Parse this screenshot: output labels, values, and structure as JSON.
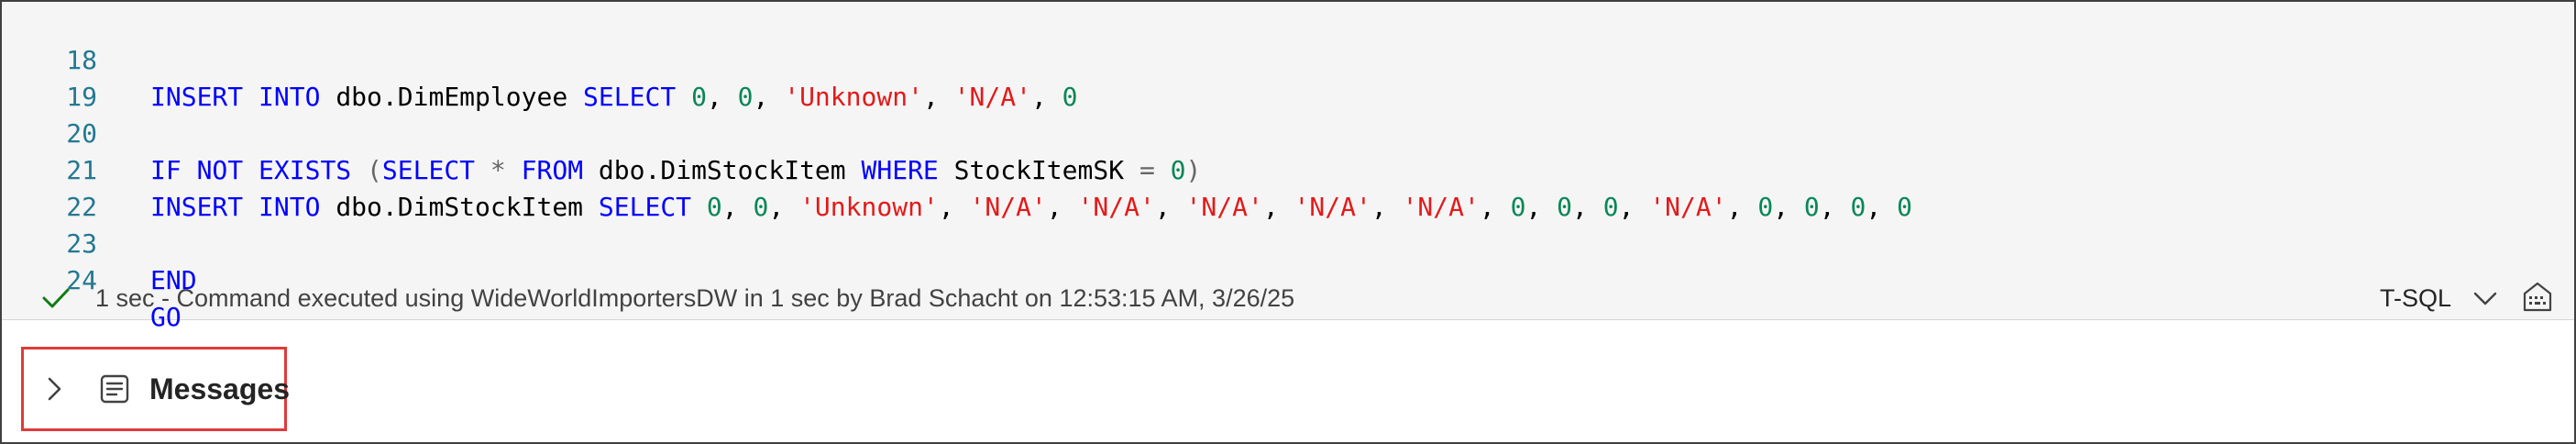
{
  "editor": {
    "lines": [
      {
        "number": "18"
      },
      {
        "number": "19"
      },
      {
        "number": "20"
      },
      {
        "number": "21"
      },
      {
        "number": "22"
      },
      {
        "number": "23"
      },
      {
        "number": "24"
      }
    ],
    "tokens": {
      "insert": "INSERT",
      "into": "INTO",
      "select": "SELECT",
      "if": "IF",
      "not": "NOT",
      "exists": "EXISTS",
      "from": "FROM",
      "where": "WHERE",
      "end": "END",
      "go": "GO",
      "dim_employee": "dbo.DimEmployee",
      "dim_stock_item": "dbo.DimStockItem",
      "stock_item_sk": "StockItemSK",
      "unknown": "'Unknown'",
      "na": "'N/A'",
      "zero": "0",
      "star": "*",
      "equals": "=",
      "open_paren": "(",
      "close_paren": ")",
      "comma": ","
    }
  },
  "status": {
    "message": "1 sec - Command executed using WideWorldImportersDW in 1 sec by Brad Schacht on 12:53:15 AM, 3/26/25",
    "language": "T-SQL"
  },
  "messages_panel": {
    "label": "Messages"
  },
  "colors": {
    "keyword": "#0000ff",
    "string": "#e31a1a",
    "number": "#098658",
    "line_number": "#237893",
    "success": "#107c10",
    "highlight_border": "#e03a3a"
  },
  "icons": [
    "check-icon",
    "chevron-down-icon",
    "keyboard-icon",
    "chevron-right-icon",
    "messages-icon"
  ]
}
